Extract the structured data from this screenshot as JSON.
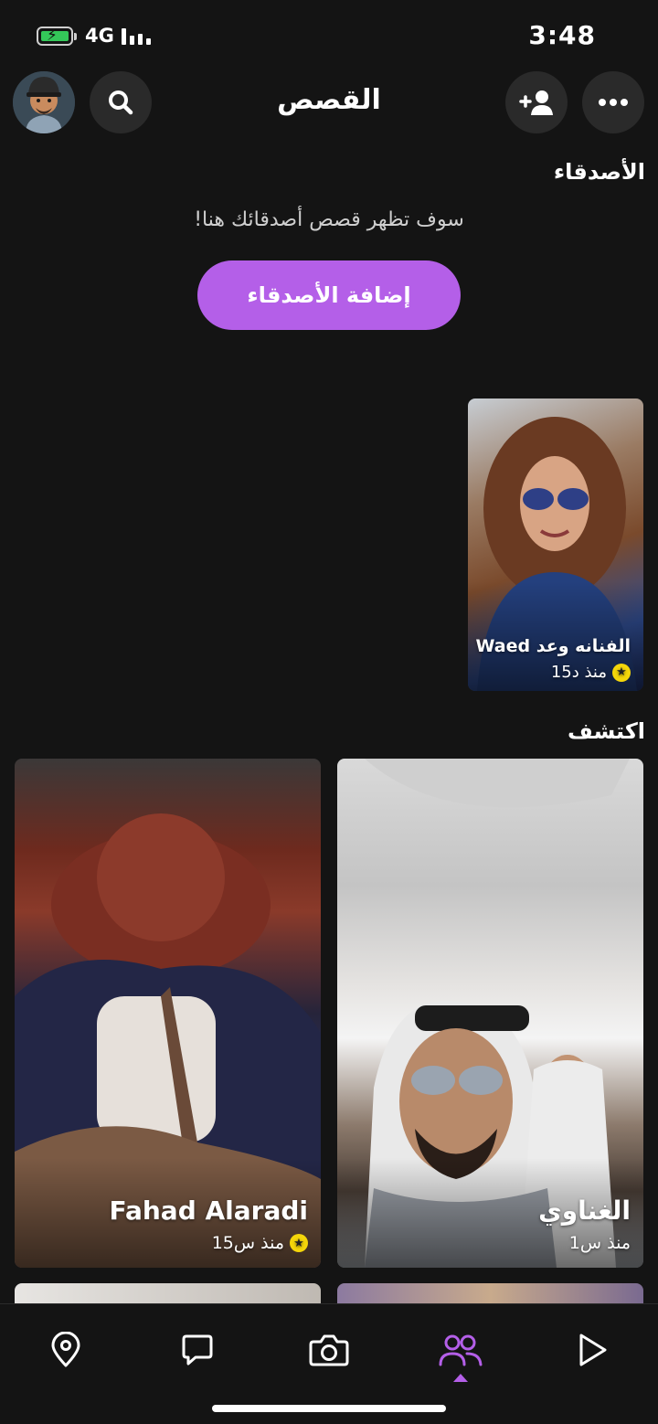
{
  "status_bar": {
    "network": "4G",
    "time": "3:48"
  },
  "header": {
    "title": "القصص"
  },
  "friends": {
    "section_title": "الأصدقاء",
    "empty_message": "سوف تظهر قصص أصدقائك هنا!",
    "add_button_label": "إضافة الأصدقاء",
    "stories": [
      {
        "name": "الفنانه وعد Waed",
        "time": "منذ د15"
      }
    ]
  },
  "discover": {
    "section_title": "اكتشف",
    "stories": [
      {
        "name": "Fahad Alaradi",
        "time": "منذ س15"
      },
      {
        "name": "الغناوي",
        "time": "منذ س1"
      }
    ]
  },
  "colors": {
    "accent": "#b45fe8",
    "background": "#141414",
    "star": "#f5d60a"
  },
  "nav": {
    "items": [
      "map-icon",
      "chat-icon",
      "camera-icon",
      "stories-icon",
      "spotlight-icon"
    ],
    "active": "stories-icon"
  }
}
